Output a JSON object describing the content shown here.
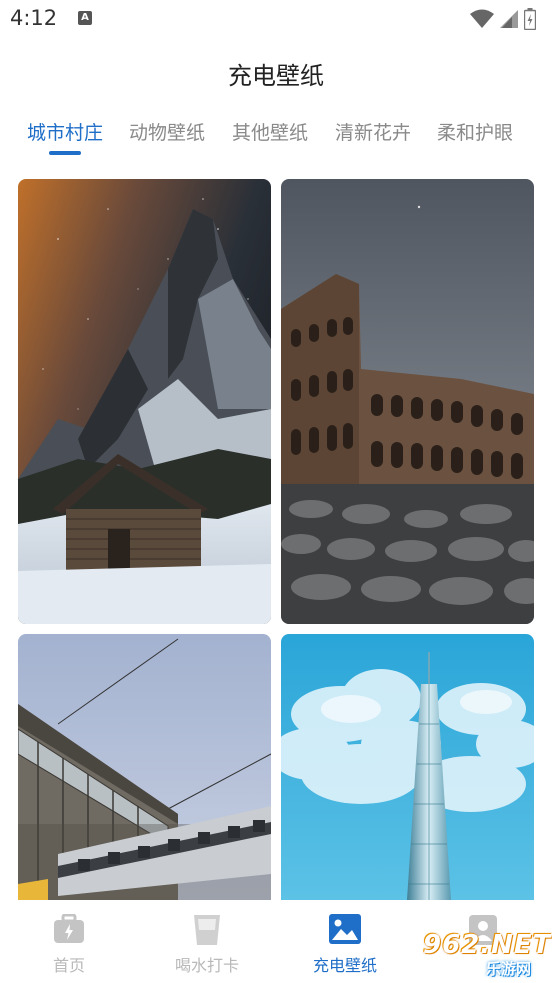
{
  "status_bar": {
    "time": "4:12",
    "notification_glyph": "A",
    "icons": [
      "wifi-icon",
      "signal-icon",
      "battery-icon"
    ]
  },
  "header": {
    "title": "充电壁纸"
  },
  "tabs": [
    {
      "label": "城市村庄",
      "active": true
    },
    {
      "label": "动物壁纸",
      "active": false
    },
    {
      "label": "其他壁纸",
      "active": false
    },
    {
      "label": "清新花卉",
      "active": false
    },
    {
      "label": "柔和护眼",
      "active": false
    }
  ],
  "wallpapers": [
    {
      "subject": "mountain-cabin-night"
    },
    {
      "subject": "colosseum"
    },
    {
      "subject": "train-building"
    },
    {
      "subject": "spire-blue-sky"
    }
  ],
  "bottom_nav": [
    {
      "label": "首页",
      "icon": "home-bag-icon",
      "active": false
    },
    {
      "label": "喝水打卡",
      "icon": "water-cup-icon",
      "active": false
    },
    {
      "label": "充电壁纸",
      "icon": "image-icon",
      "active": true
    },
    {
      "label": "",
      "icon": "profile-icon",
      "active": false
    }
  ],
  "watermark": {
    "main": "962.NET",
    "sub": "乐游网"
  },
  "colors": {
    "accent": "#1f6ec8",
    "inactive_tab": "#8a8a8a",
    "inactive_nav": "#b9b9b9"
  }
}
